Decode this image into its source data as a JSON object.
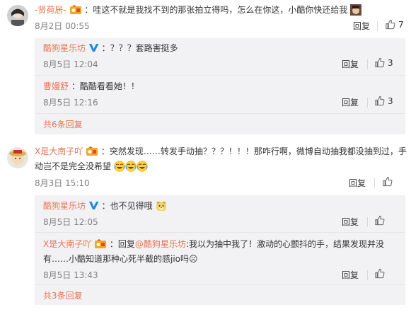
{
  "comments": [
    {
      "username": "-贤荷居-",
      "text": "：哇这不就是我找不到的那张拍立得吗，怎么在你这，小酷你快还给我",
      "time": "8月2日 00:55",
      "reply_label": "回复",
      "like_count": "7",
      "replies": [
        {
          "username": "酷狗星乐坊",
          "text": "：？？？套路害挺多",
          "time": "8月5日 12:04",
          "reply_label": "回复",
          "like_count": "3"
        },
        {
          "username": "曹嫚舒",
          "text": "：酷酷看看她！！",
          "time": "8月5日 12:16",
          "reply_label": "回复",
          "like_count": "3"
        }
      ],
      "more_label": "共6条回复"
    },
    {
      "username": "X是大南子吖",
      "text_line1": "：突然发现……转发手动抽？？？！！！那咋行啊，微博自动抽我都没抽到过，手",
      "text_line2": "动岂不是完全没希望",
      "time": "8月3日 15:10",
      "reply_label": "回复",
      "like_count": "",
      "replies": [
        {
          "username": "酷狗星乐坊",
          "text": "：也不见得哦",
          "time": "8月5日 12:05",
          "reply_label": "回复",
          "like_count": ""
        },
        {
          "username": "X是大南子吖",
          "text_prefix": "：回复",
          "mention": "@酷狗星乐坊",
          "text_line1": ":我以为抽中我了！激动的心颤抖的手，结果发现并没",
          "text_line2": "有……小酷知道那种心死半截的感jio吗☹",
          "time": "8月5日 13:43",
          "reply_label": "回复",
          "like_count": ""
        }
      ],
      "more_label": "共3条回复"
    }
  ],
  "icons": [
    "avatar-1",
    "avatar-2",
    "vip-badge-icon",
    "verified-v-icon",
    "thumbs-up-icon",
    "crying-laugh-emoji",
    "doge-emoji"
  ],
  "colors": {
    "username": "#eb7350",
    "verified": "#1d8de0",
    "reply_bg": "#f2f2f5",
    "meta": "#808080"
  }
}
